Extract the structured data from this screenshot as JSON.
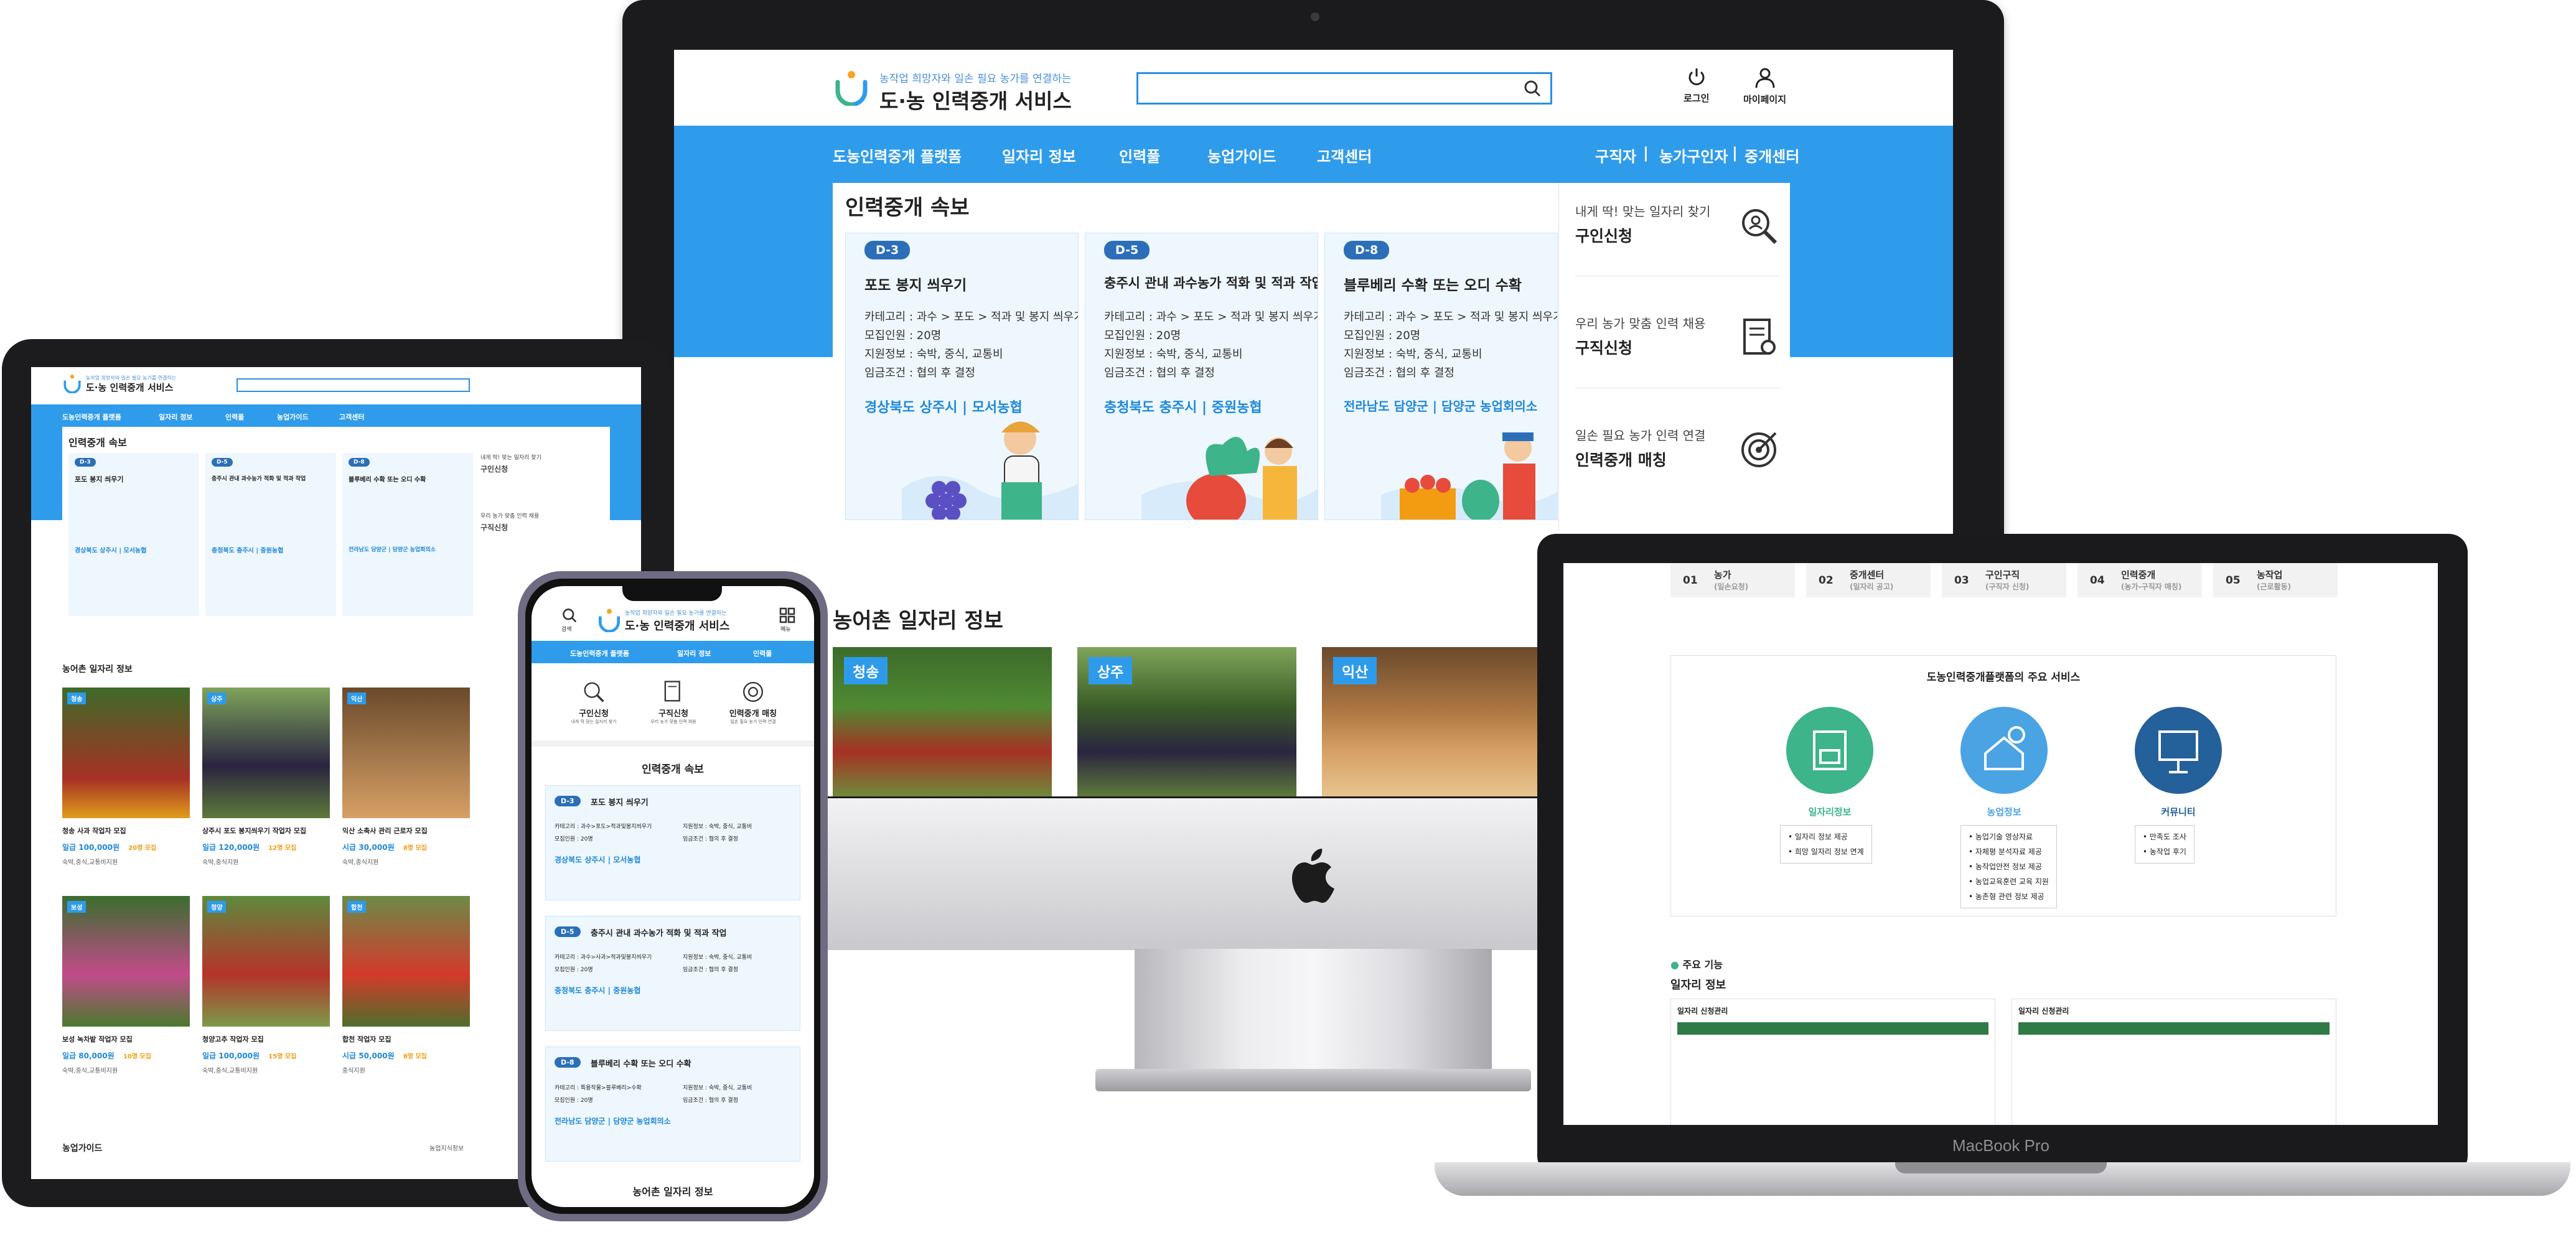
{
  "site": {
    "tagline": "농작업 희망자와 일손 필요 농가를 연결하는",
    "name": "도·농 인력중개 서비스",
    "util": {
      "login": "로그인",
      "mypage": "마이페이지"
    },
    "nav": [
      "도농인력중개 플랫폼",
      "일자리 정보",
      "인력풀",
      "농업가이드",
      "고객센터"
    ],
    "nav_right": [
      "구직자",
      "|",
      "농가구인자",
      "|",
      "중개센터"
    ],
    "flash_title": "인력중개 속보",
    "cards": [
      {
        "dday": "D-3",
        "title": "포도 봉지 씌우기",
        "info": [
          "카테고리 : 과수 > 포도 > 적과 및 봉지 씌우기",
          "모집인원 : 20명",
          "지원정보 : 숙박, 중식, 교통비",
          "임금조건 : 협의 후 결정"
        ],
        "loc": "경상북도  상주시  |  모서농협"
      },
      {
        "dday": "D-5",
        "title": "충주시 관내 과수농가 적화 및 적과 작업",
        "info": [
          "카테고리 : 과수 > 포도 > 적과 및 봉지 씌우기",
          "모집인원 : 20명",
          "지원정보 : 숙박, 중식, 교통비",
          "임금조건 : 협의 후 결정"
        ],
        "loc": "충청북도  충주시  |  중원농협"
      },
      {
        "dday": "D-8",
        "title": "블루베리 수확 또는 오디 수확",
        "info": [
          "카테고리 : 과수 > 포도 > 적과 및 봉지 씌우기",
          "모집인원 : 20명",
          "지원정보 : 숙박, 중식, 교통비",
          "임금조건 : 협의 후 결정"
        ],
        "loc": "전라남도  담양군  |  담양군 농업회의소"
      }
    ],
    "side": [
      {
        "sub": "내게 딱! 맞는 일자리 찾기",
        "main": "구인신청"
      },
      {
        "sub": "우리 농가 맞춤 인력 채용",
        "main": "구직신청"
      },
      {
        "sub": "일손 필요 농가 인력 연결",
        "main": "인력중개 매칭"
      }
    ],
    "jobs_title": "농어촌 일자리 정보",
    "photo_badges": [
      "청송",
      "상주",
      "익산"
    ]
  },
  "macbook": {
    "label": "MacBook Pro",
    "steps": [
      {
        "no": "01",
        "name": "농가",
        "sub": "(일손요청)"
      },
      {
        "no": "02",
        "name": "중개센터",
        "sub": "(일자리 공고)"
      },
      {
        "no": "03",
        "name": "구인구직",
        "sub": "(구직자 신청)"
      },
      {
        "no": "04",
        "name": "인력중개",
        "sub": "(농가-구직자 매칭)"
      },
      {
        "no": "05",
        "name": "농작업",
        "sub": "(근로활동)"
      }
    ],
    "svc_title": "도농인력중개플랫폼의 주요 서비스",
    "services": [
      {
        "label": "일자리정보",
        "items": [
          "• 일자리 정보 제공",
          "• 희망 일자리 정보 연계"
        ]
      },
      {
        "label": "농업정보",
        "items": [
          "• 농업기술 영상자료",
          "• 자체평 분석자료 제공",
          "• 농작업안전 정보 제공",
          "• 농업교육훈련 교육 지원",
          "• 농촌형 관련 정보 제공"
        ]
      },
      {
        "label": "커뮤니티",
        "items": [
          "• 만족도 조사",
          "• 농작업 후기"
        ]
      }
    ],
    "feature_label": "주요 기능",
    "feature_title": "일자리 정보",
    "panel_titles": [
      "일자리 신청관리",
      "일자리 신청관리"
    ]
  },
  "tablet": {
    "jobs_title": "농어촌 일자리 정보",
    "jobs": [
      {
        "badge": "청송",
        "title": "청송 사과 작업자 모집",
        "wage_type": "일급",
        "wage": "100,000원",
        "count": "20명 모집",
        "benefit": "숙박,중식,교통비지원"
      },
      {
        "badge": "상주",
        "title": "상주시 포도 봉지씌우기 작업자 모집",
        "wage_type": "일급",
        "wage": "120,000원",
        "count": "12명 모집",
        "benefit": "숙박,중식지원"
      },
      {
        "badge": "익산",
        "title": "익산 소축사 관리 근로자 모집",
        "wage_type": "시급",
        "wage": "30,000원",
        "count": "8명 모집",
        "benefit": "숙박,중식지원"
      },
      {
        "badge": "보성",
        "title": "보성 녹차밭 작업자 모집",
        "wage_type": "일급",
        "wage": "80,000원",
        "count": "10명 모집",
        "benefit": "숙박,중식,교통비지원"
      },
      {
        "badge": "청양",
        "title": "청양고추 작업자 모집",
        "wage_type": "일급",
        "wage": "100,000원",
        "count": "15명 모집",
        "benefit": "숙박,중식,교통비지원"
      },
      {
        "badge": "합천",
        "title": "합천 작업자 모집",
        "wage_type": "시급",
        "wage": "50,000원",
        "count": "8명 모집",
        "benefit": "중식지원"
      }
    ],
    "guide_title": "농업가이드",
    "guide_link": "농업지식정보"
  },
  "phone": {
    "search_label": "검색",
    "menu_label": "메뉴",
    "quick": [
      {
        "main": "구인신청",
        "sub": "내게 딱 맞는 일자리 찾기"
      },
      {
        "main": "구직신청",
        "sub": "우리 농가 맞춤 인력 채용"
      },
      {
        "main": "인력중개 매칭",
        "sub": "일손 필요 농가 인력 연결"
      }
    ],
    "flash_title": "인력중개 속보",
    "cards": [
      {
        "dday": "D-3",
        "title": "포도 봉지 씌우기",
        "left": [
          "카테고리 : 과수>포도>적과및봉지씌우기",
          "모집인원 : 20명"
        ],
        "right": [
          "지원정보 : 숙박, 중식, 교통비",
          "임금조건 : 협의 후 결정"
        ],
        "loc": "경상북도  상주시  |  모서농협"
      },
      {
        "dday": "D-5",
        "title": "충주시 관내 과수농가 적화 및 적과 작업",
        "left": [
          "카테고리 : 과수>사과>적과및봉지씌우기",
          "모집인원 : 20명"
        ],
        "right": [
          "지원정보 : 숙박, 중식, 교통비",
          "임금조건 : 협의 후 결정"
        ],
        "loc": "충청북도  충주시  |  중원농협"
      },
      {
        "dday": "D-8",
        "title": "블루베리 수확 또는 오디 수확",
        "left": [
          "카테고리 : 특용작물>블루베리>수확",
          "모집인원 : 20명"
        ],
        "right": [
          "지원정보 : 숙박, 중식, 교통비",
          "임금조건 : 협의 후 결정"
        ],
        "loc": "전라남도  담양군  |  담양군 농업회의소"
      }
    ],
    "jobs_title": "농어촌 일자리 정보"
  },
  "colors": {
    "primary": "#2f9ceb",
    "dark_blue": "#2c6fb8",
    "link_blue": "#1e88d9",
    "orange": "#f39c12",
    "green": "#3db489"
  }
}
